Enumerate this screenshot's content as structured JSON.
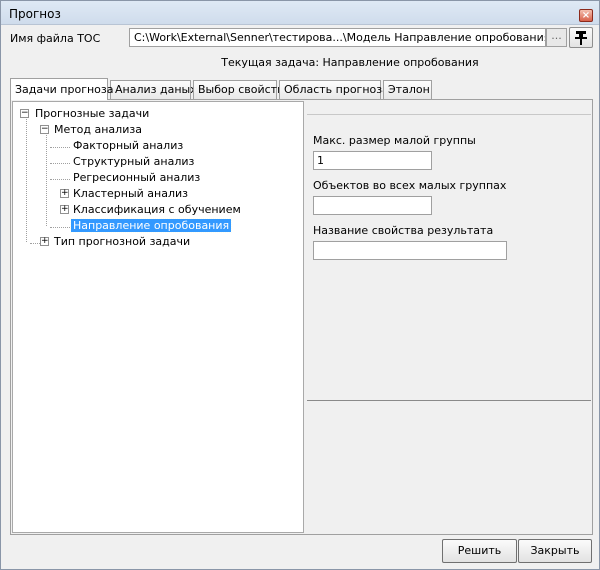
{
  "window": {
    "title": "Прогноз",
    "close_label": "×"
  },
  "toc": {
    "label": "Имя файла TOC",
    "value": "C:\\Work\\External\\Senner\\тестирова...\\Модель Направление опробования.pgrid",
    "browse_label": "..."
  },
  "current_task": "Текущая задача: Направление опробования",
  "tabs": [
    {
      "label": "Задачи прогноза",
      "active": true
    },
    {
      "label": "Анализ даных",
      "active": false
    },
    {
      "label": "Выбор свойств",
      "active": false
    },
    {
      "label": "Область прогноза",
      "active": false
    },
    {
      "label": "Эталон",
      "active": false
    }
  ],
  "tree": {
    "root": "Прогнозные задачи",
    "method": "Метод анализа",
    "items": [
      "Факторный анализ",
      "Структурный анализ",
      "Регресионный анализ",
      "Кластерный анализ",
      "Классификация с обучением",
      "Направление опробования"
    ],
    "selected": "Направление опробования",
    "task_type": "Тип прогнозной задачи"
  },
  "properties": {
    "max_group_size_label": "Макс. размер малой группы",
    "max_group_size_value": "1",
    "objects_in_groups_label": "Объектов во всех малых группах",
    "objects_in_groups_value": "",
    "result_property_label": "Название свойства результата",
    "result_property_value": ""
  },
  "buttons": {
    "solve": "Решить",
    "close": "Закрыть"
  },
  "colors": {
    "selection": "#3399ff",
    "window_bg": "#f0f0f0"
  }
}
